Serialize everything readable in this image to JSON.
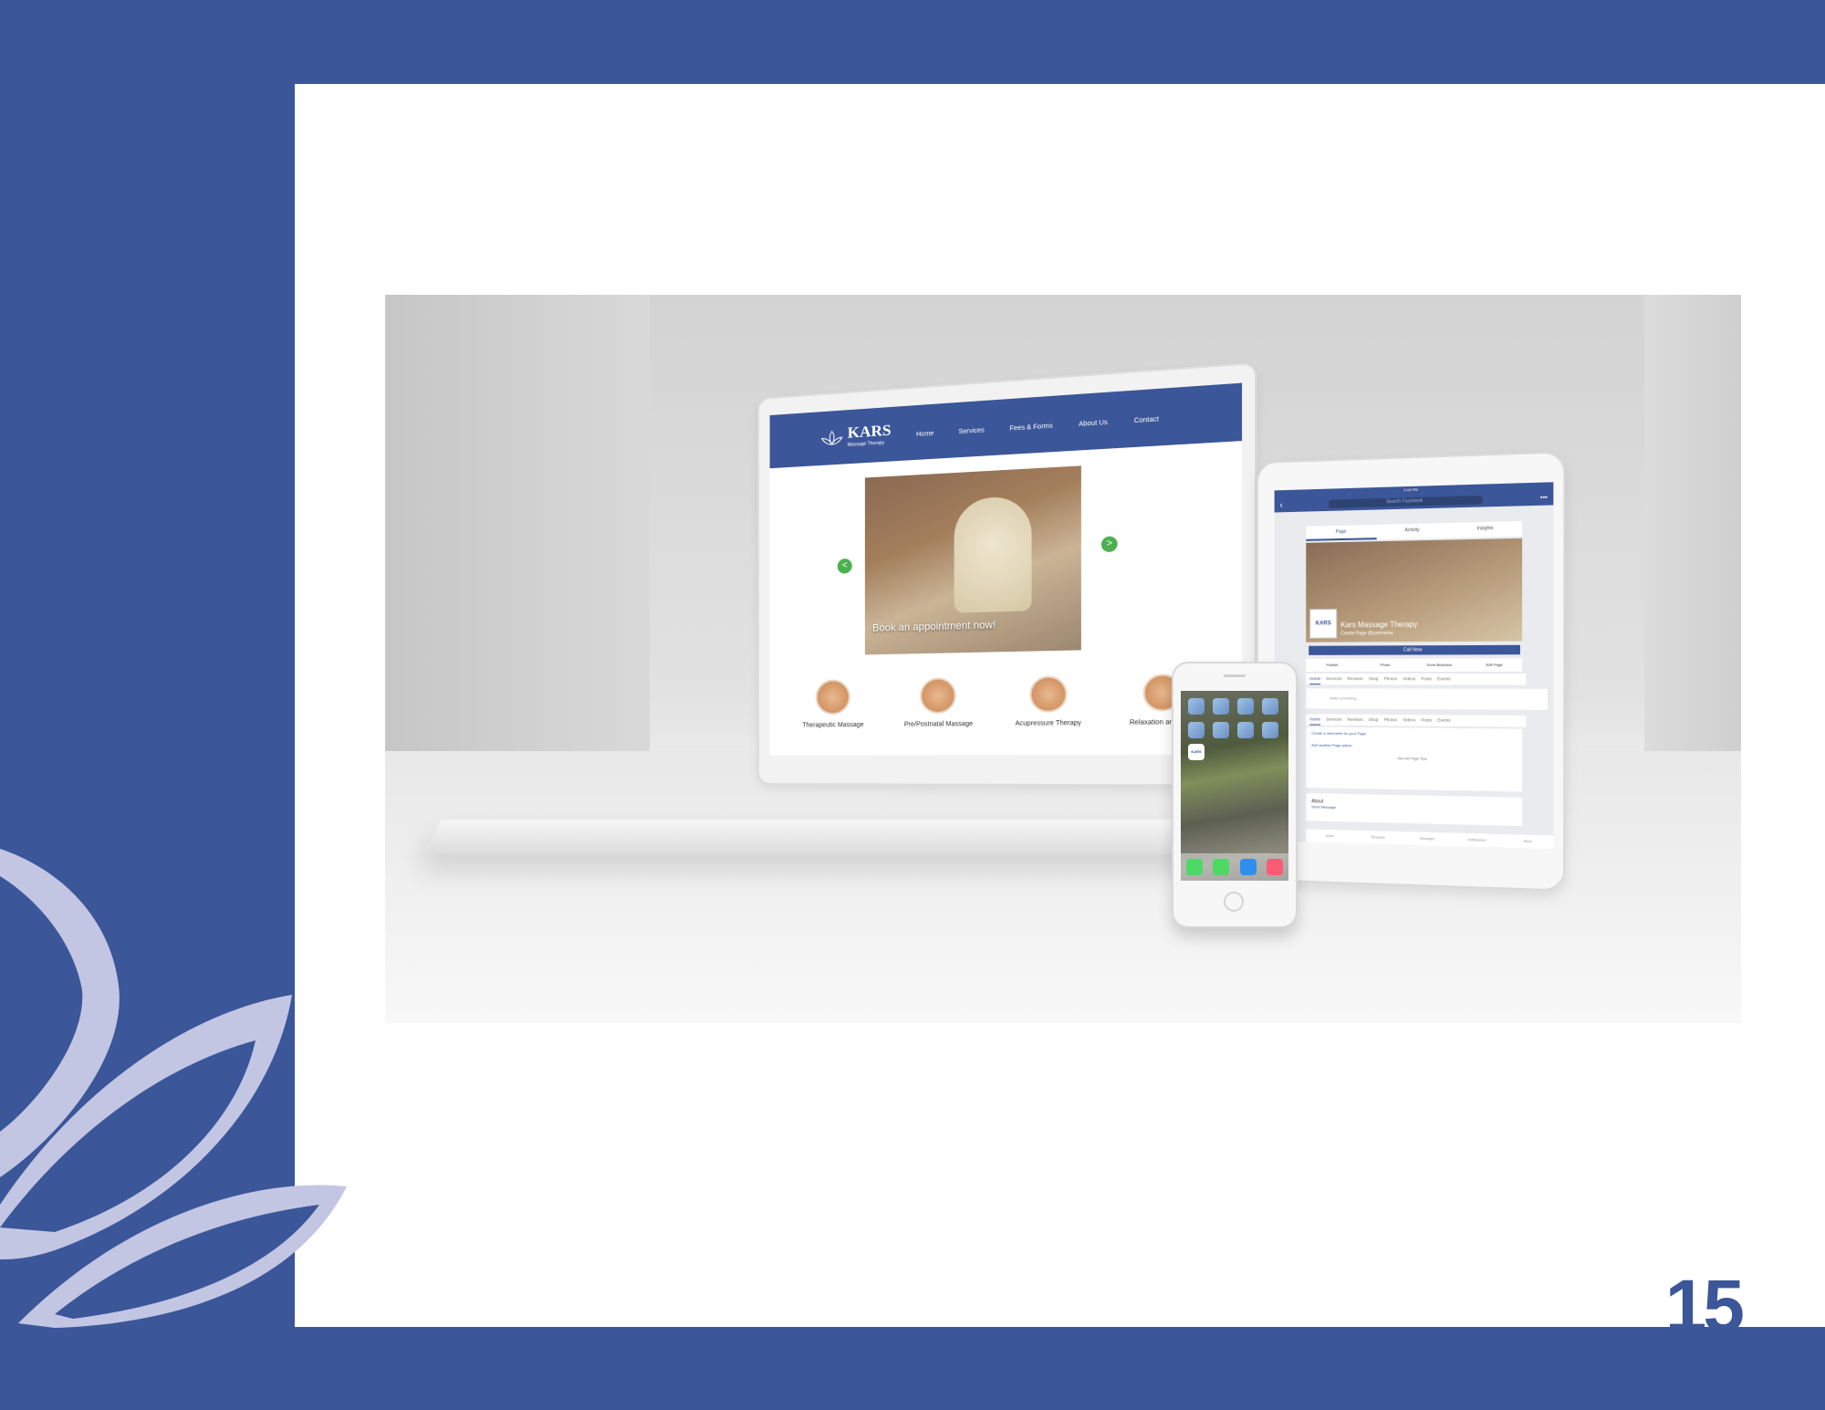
{
  "page": {
    "number": "15",
    "colors": {
      "brand": "#3b5699",
      "lotus": "#c3c6e3",
      "panel": "#ffffff"
    }
  },
  "website": {
    "logo": {
      "name": "KARS",
      "tagline": "Massage Therapy"
    },
    "nav": [
      "Home",
      "Services",
      "Fees & Forms",
      "About Us",
      "Contact"
    ],
    "carousel": {
      "caption": "Book an appointment now!",
      "prev": "<",
      "next": ">"
    },
    "services": [
      "Therapeutic Massage",
      "Pre/Postnatal Massage",
      "Acupressure Therapy",
      "Relaxation and Yoga"
    ]
  },
  "facebook": {
    "status": "9:15 PM",
    "search_placeholder": "Search Facebook",
    "tabs": [
      "Page",
      "Activity",
      "Insights"
    ],
    "profile_label": "KARS",
    "page_name": "Kars Massage Therapy",
    "username_hint": "Create Page @username",
    "call_button": "Call Now",
    "actions": [
      "Publish",
      "Photo",
      "Grow Business",
      "Edit Page"
    ],
    "subtabs": [
      "Home",
      "Services",
      "Reviews",
      "Shop",
      "Photos",
      "Videos",
      "Posts",
      "Events"
    ],
    "write_placeholder": "Write something...",
    "tips": [
      "Create a username for your Page",
      "Add another Page admin"
    ],
    "see_all": "See All Page Tips",
    "about": "About",
    "send_message": "Send Message",
    "bottom_nav": [
      "Home",
      "Requests",
      "Messages",
      "Notifications",
      "More"
    ]
  },
  "phone": {
    "app_label": "KARS"
  }
}
